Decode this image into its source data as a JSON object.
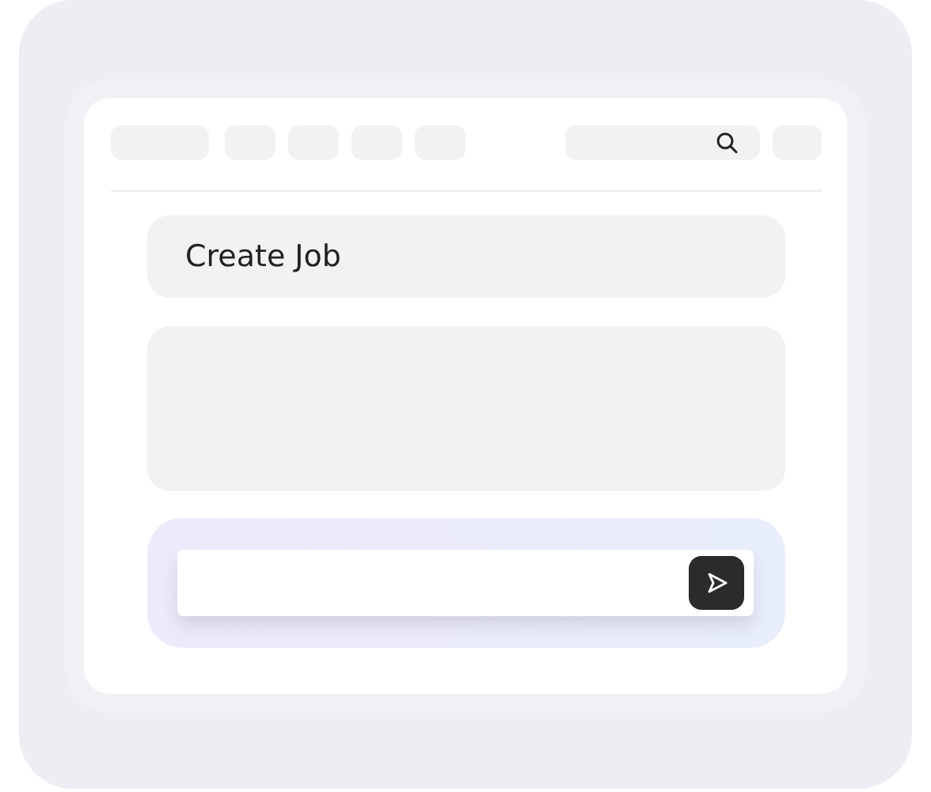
{
  "job_card": {
    "title": "Create Job"
  }
}
